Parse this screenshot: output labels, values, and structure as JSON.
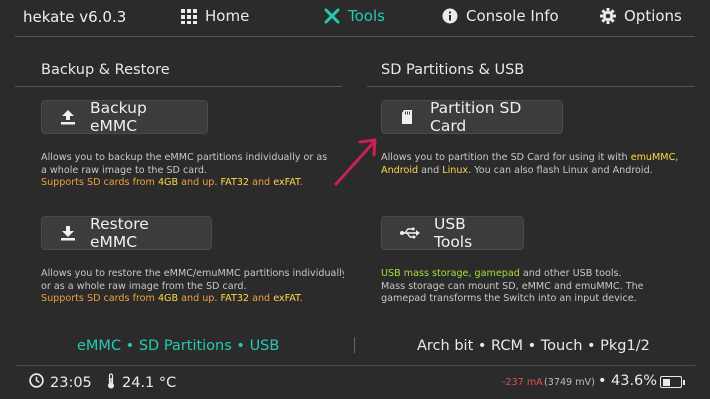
{
  "header": {
    "title": "hekate v6.0.3",
    "tabs": [
      {
        "label": "Home",
        "icon": "grid-icon"
      },
      {
        "label": "Tools",
        "icon": "tools-icon",
        "active": true
      },
      {
        "label": "Console Info",
        "icon": "info-icon"
      },
      {
        "label": "Options",
        "icon": "gear-icon"
      }
    ]
  },
  "left": {
    "section_title": "Backup & Restore",
    "backup": {
      "label": "Backup eMMC",
      "desc": {
        "l1": "Allows you to backup the eMMC partitions individually or as",
        "l2": "a whole raw image to the SD card.",
        "l3a": "Supports SD cards from ",
        "l3b": "4GB",
        "l3c": " and up. ",
        "l3d": "FAT32",
        "l3e": " and ",
        "l3f": "exFAT",
        "l3g": "."
      }
    },
    "restore": {
      "label": "Restore eMMC",
      "desc": {
        "l1": "Allows you to restore the eMMC/emuMMC partitions individually",
        "l2": "or as a whole raw image from the SD card.",
        "l3a": "Supports SD cards from ",
        "l3b": "4GB",
        "l3c": " and up. ",
        "l3d": "FAT32",
        "l3e": " and ",
        "l3f": "exFAT",
        "l3g": "."
      }
    }
  },
  "right": {
    "section_title": "SD Partitions & USB",
    "partition": {
      "label": "Partition SD Card",
      "desc": {
        "l1a": "Allows you to partition the SD Card for using it with ",
        "l1b": "emuMMC",
        "l1c": ",",
        "l2a": "Android",
        "l2b": " and ",
        "l2c": "Linux",
        "l2d": ". You can also flash Linux and Android."
      }
    },
    "usb": {
      "label": "USB Tools",
      "desc": {
        "l1a": "USB mass storage, gamepad",
        "l1b": " and other USB tools.",
        "l2": "Mass storage can mount SD, eMMC and emuMMC. The",
        "l3": "gamepad transforms the Switch into an input device."
      }
    }
  },
  "footer": {
    "left": "eMMC • SD Partitions • USB",
    "right": "Arch bit • RCM • Touch • Pkg1/2"
  },
  "status": {
    "time": "23:05",
    "temperature": "24.1 °C",
    "current": "-237 mA",
    "voltage": "(3749 mV)",
    "battery_separator": "•",
    "battery_percent": "43.6%",
    "battery_level": 0.436
  },
  "colors": {
    "accent": "#27c9b0",
    "orange": "#f0a040",
    "yellow": "#ffd84a",
    "green": "#a6df3a",
    "arrow": "#c8234f"
  }
}
